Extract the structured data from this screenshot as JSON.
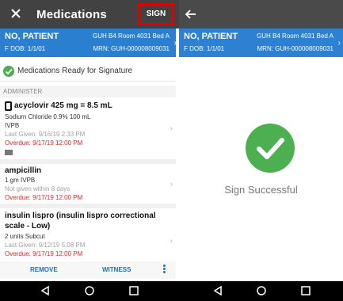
{
  "left": {
    "header": {
      "title": "Medications",
      "sign_label": "SIGN"
    },
    "patient": {
      "name": "NO, PATIENT",
      "dob": "F  DOB: 1/1/01",
      "room": "GUH B4 Room 4031 Bed A",
      "mrn": "MRN: GUH-000008009031"
    },
    "ready_text": "Medications Ready for Signature",
    "section_label": "ADMINISTER",
    "meds": [
      {
        "name": "acyclovir 425 mg = 8.5 mL",
        "lines": [
          "Sodium Chloride 0.9% 100 mL",
          "IVPB"
        ],
        "last_given": "Last Given: 9/16/19 2:33 PM",
        "overdue": "Overdue: 9/17/19 12:00 PM"
      },
      {
        "name": "ampicillin",
        "lines": [
          "1 gm IVPB"
        ],
        "last_given": "Not given within 8 days",
        "overdue": "Overdue: 9/17/19 12:00 PM"
      },
      {
        "name_line1": "insulin lispro (insulin lispro correctional",
        "name_line2": "scale - Low)",
        "lines": [
          "2 units Subcut"
        ],
        "last_given": "Last Given: 9/12/19 5:08 PM",
        "overdue": "Overdue: 9/17/19 12:00 PM"
      }
    ],
    "actions": {
      "remove": "REMOVE",
      "witness": "WITNESS"
    }
  },
  "right": {
    "patient": {
      "name": "NO, PATIENT",
      "dob": "F  DOB: 1/1/01",
      "room": "GUH B4 Room 4031 Bed A",
      "mrn": "MRN: GUH-000008009031"
    },
    "success_text": "Sign Successful"
  },
  "colors": {
    "topbar": "#424242",
    "patient_bar": "#2b7fd1",
    "success_green": "#4caf50",
    "overdue_red": "#e32b2b",
    "link_blue": "#1f6fc4",
    "highlight_box": "#e00000"
  },
  "icons": [
    "close-icon",
    "back-arrow-icon",
    "check-circle-icon",
    "chevron-right-icon",
    "more-vert-icon",
    "nav-back-icon",
    "nav-home-icon",
    "nav-recents-icon"
  ]
}
